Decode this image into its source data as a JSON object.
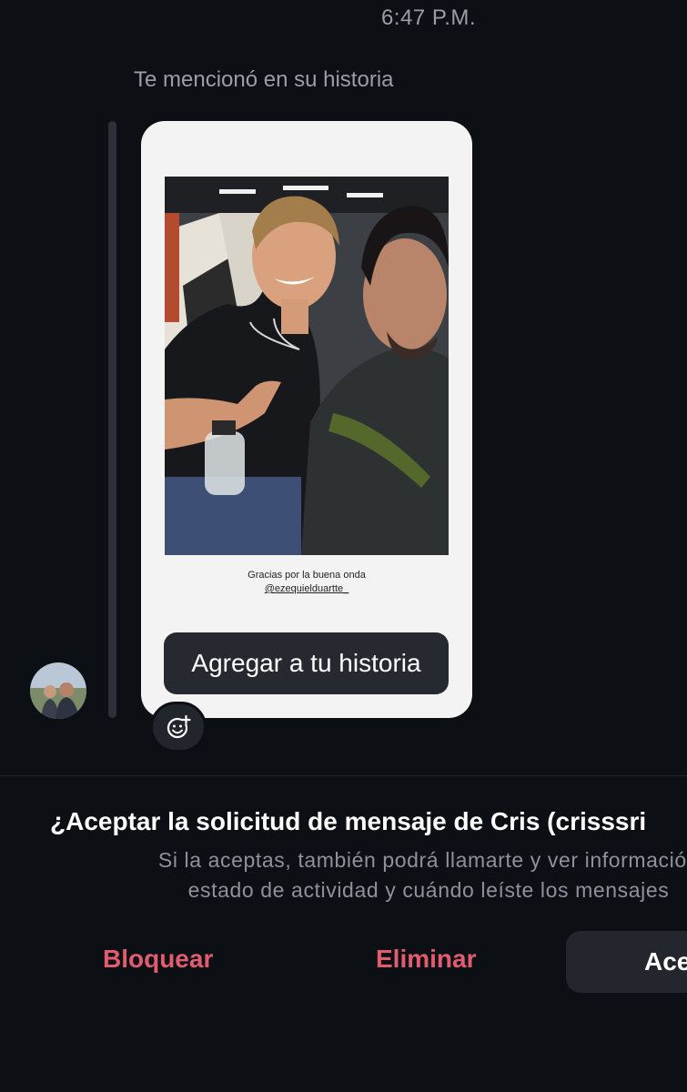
{
  "chat": {
    "timestamp": "6:47 P.M.",
    "mention_label": "Te mencionó en su historia",
    "story": {
      "caption_line1": "Gracias por la buena onda",
      "caption_handle": "@ezequielduartte_",
      "add_to_story_label": "Agregar a tu historia",
      "react_icon": "add-reaction-icon"
    },
    "avatar_icon": "profile-avatar"
  },
  "request": {
    "title": "¿Aceptar la solicitud de mensaje de Cris (crisssri",
    "desc_line1": "Si la aceptas, también podrá llamarte y ver información",
    "desc_line2": "estado de actividad y cuándo leíste los mensajes",
    "block_label": "Bloquear",
    "delete_label": "Eliminar",
    "accept_label": "Ace"
  },
  "colors": {
    "background": "#0c0f14",
    "danger": "#e25c70",
    "button_bg": "#23262c"
  }
}
